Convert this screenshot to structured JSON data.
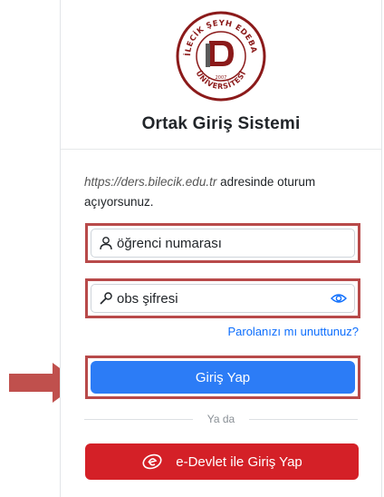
{
  "university": {
    "logo_text_top": "BİLECİK ŞEYH EDEBALİ",
    "logo_text_bottom": "ÜNİVERSİTESİ",
    "logo_year": "2007"
  },
  "page_title": "Ortak Giriş Sistemi",
  "info": {
    "url": "https://ders.bilecik.edu.tr",
    "suffix": " adresinde oturum açıyorsunuz."
  },
  "username_field": {
    "placeholder": "öğrenci numarası",
    "icon": "person-icon"
  },
  "password_field": {
    "placeholder": "obs şifresi",
    "icon": "key-icon",
    "toggle_icon": "eye-icon"
  },
  "forgot_link": "Parolanızı mı unuttunuz?",
  "login_button": "Giriş Yap",
  "divider_label": "Ya da",
  "edevlet_button": "e-Devlet ile Giriş Yap",
  "colors": {
    "primary": "#2c7cf6",
    "edevlet": "#d42027",
    "highlight": "#b84a4a",
    "link": "#0d6efd"
  }
}
